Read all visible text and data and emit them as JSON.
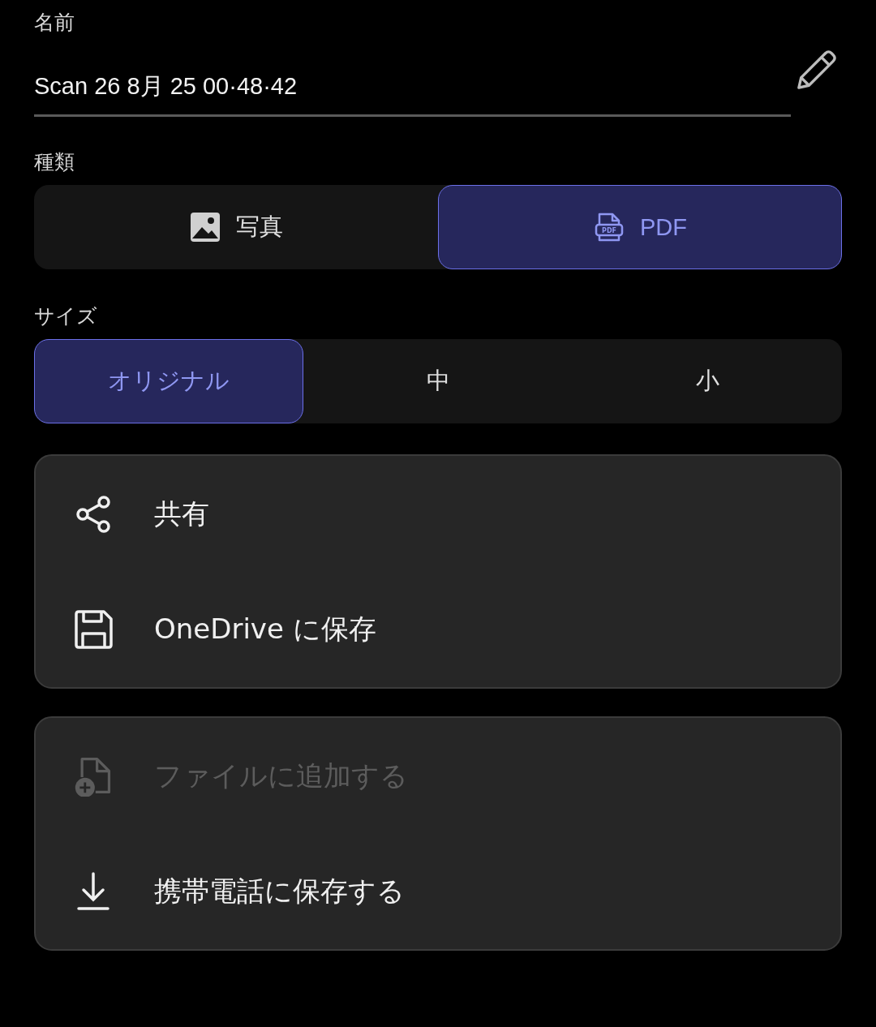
{
  "name_label": "名前",
  "name_field": {
    "value": "Scan 26 8月 25 00·48·42"
  },
  "type_label": "種類",
  "type_options": [
    {
      "kind": "image",
      "label": "写真",
      "selected": false
    },
    {
      "kind": "pdf",
      "label": "PDF",
      "icon_text": "PDF",
      "selected": true
    }
  ],
  "size_label": "サイズ",
  "size_options": [
    {
      "label": "オリジナル",
      "selected": true
    },
    {
      "label": "中",
      "selected": false
    },
    {
      "label": "小",
      "selected": false
    }
  ],
  "action_groups": [
    [
      {
        "kind": "share",
        "label": "共有",
        "disabled": false
      },
      {
        "kind": "save",
        "label": "OneDrive に保存",
        "disabled": false
      }
    ],
    [
      {
        "kind": "add-file",
        "label": "ファイルに追加する",
        "disabled": true
      },
      {
        "kind": "download",
        "label": "携帯電話に保存する",
        "disabled": false
      }
    ]
  ]
}
